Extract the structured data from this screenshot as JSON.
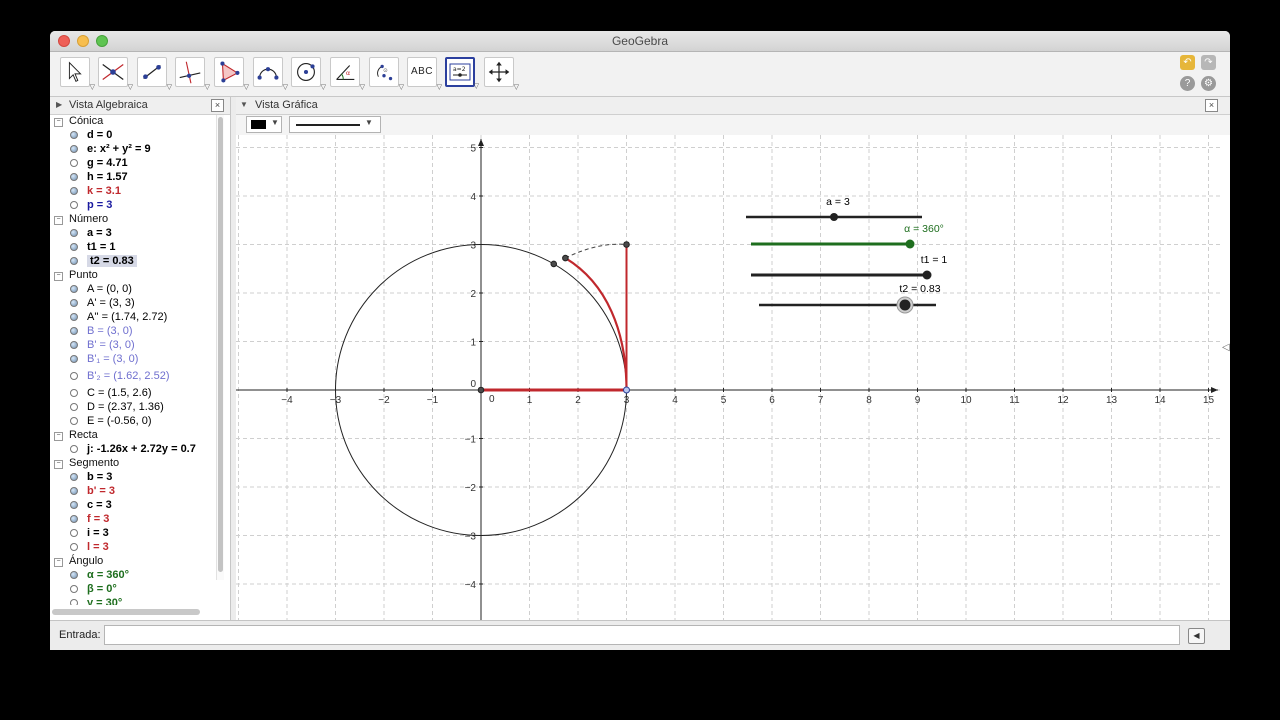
{
  "window": {
    "title": "GeoGebra"
  },
  "algebra_view": {
    "title": "Vista Algebraica",
    "categories": [
      {
        "name": "Cónica",
        "items": [
          {
            "text": "d = 0",
            "color": "#000000",
            "visible": true
          },
          {
            "text": "e: x² + y² = 9",
            "color": "#000000",
            "visible": true
          },
          {
            "text": "g = 4.71",
            "color": "#000000",
            "visible": false
          },
          {
            "text": "h = 1.57",
            "color": "#000000",
            "visible": true
          },
          {
            "text": "k = 3.1",
            "color": "#c0282d",
            "visible": true
          },
          {
            "text": "p = 3",
            "color": "#1a1aa0",
            "visible": false
          }
        ]
      },
      {
        "name": "Número",
        "items": [
          {
            "text": "a = 3",
            "color": "#000000",
            "visible": true
          },
          {
            "text": "t1 = 1",
            "color": "#000000",
            "visible": true
          },
          {
            "text": "t2 = 0.83",
            "color": "#000000",
            "visible": true,
            "selected": true
          }
        ]
      },
      {
        "name": "Punto",
        "items": [
          {
            "text": "A = (0, 0)",
            "color": "#000000",
            "visible": true,
            "plain": true
          },
          {
            "text": "A' = (3, 3)",
            "color": "#000000",
            "visible": true,
            "plain": true
          },
          {
            "text": "A'' = (1.74, 2.72)",
            "color": "#000000",
            "visible": true,
            "plain": true
          },
          {
            "text": "B = (3, 0)",
            "color": "#6f6fcf",
            "visible": true,
            "plain": true
          },
          {
            "text": "B' = (3, 0)",
            "color": "#6f6fcf",
            "visible": true,
            "plain": true
          },
          {
            "text": "B'₁ = (3, 0)",
            "color": "#6f6fcf",
            "visible": true,
            "plain": true
          },
          {
            "text": "B'₂ = (1.62, 2.52)",
            "color": "#6f6fcf",
            "visible": false,
            "plain": true
          },
          {
            "text": "C = (1.5, 2.6)",
            "color": "#000000",
            "visible": false,
            "plain": true
          },
          {
            "text": "D = (2.37, 1.36)",
            "color": "#000000",
            "visible": false,
            "plain": true
          },
          {
            "text": "E = (-0.56, 0)",
            "color": "#000000",
            "visible": false,
            "plain": true
          }
        ]
      },
      {
        "name": "Recta",
        "items": [
          {
            "text": "j: -1.26x + 2.72y = 0.7",
            "color": "#000000",
            "visible": false
          }
        ]
      },
      {
        "name": "Segmento",
        "items": [
          {
            "text": "b = 3",
            "color": "#000000",
            "visible": true
          },
          {
            "text": "b' = 3",
            "color": "#c0282d",
            "visible": true
          },
          {
            "text": "c = 3",
            "color": "#000000",
            "visible": true
          },
          {
            "text": "f = 3",
            "color": "#c0282d",
            "visible": true
          },
          {
            "text": "i = 3",
            "color": "#000000",
            "visible": false
          },
          {
            "text": "l = 3",
            "color": "#c0282d",
            "visible": false
          }
        ]
      },
      {
        "name": "Ángulo",
        "items": [
          {
            "text": "α = 360°",
            "color": "#1e6e1e",
            "visible": true
          },
          {
            "text": "β = 0°",
            "color": "#1e6e1e",
            "visible": false
          },
          {
            "text": "γ = 30°",
            "color": "#1e6e1e",
            "visible": false
          }
        ]
      }
    ]
  },
  "graphics_view": {
    "title": "Vista Gráfica",
    "x_ticks": [
      -4,
      -3,
      -2,
      -1,
      1,
      2,
      3,
      4,
      5,
      6,
      7,
      8,
      9,
      10,
      11,
      12,
      13,
      14,
      15
    ],
    "y_ticks": [
      5,
      4,
      3,
      2,
      1,
      -1,
      -2,
      -3,
      -4
    ],
    "origin_labels": {
      "x": "0",
      "y": "0"
    },
    "circle": {
      "cx": 0,
      "cy": 0,
      "r": 3
    },
    "points": [
      {
        "x": 0,
        "y": 0
      },
      {
        "x": 3,
        "y": 0
      },
      {
        "x": 3,
        "y": 3
      },
      {
        "x": 1.74,
        "y": 2.72
      },
      {
        "x": 1.5,
        "y": 2.6
      }
    ],
    "sliders": [
      {
        "label": "a = 3",
        "color": "#000000"
      },
      {
        "label": "α = 360°",
        "color": "#1e6e1e"
      },
      {
        "label": "t1 = 1",
        "color": "#000000"
      },
      {
        "label": "t2 = 0.83",
        "color": "#000000"
      }
    ]
  },
  "input_bar": {
    "label": "Entrada:",
    "value": "",
    "placeholder": ""
  },
  "colors": {
    "accent_red": "#c0282d",
    "slider_green": "#1e6e1e",
    "grid": "#cfcfcf"
  }
}
